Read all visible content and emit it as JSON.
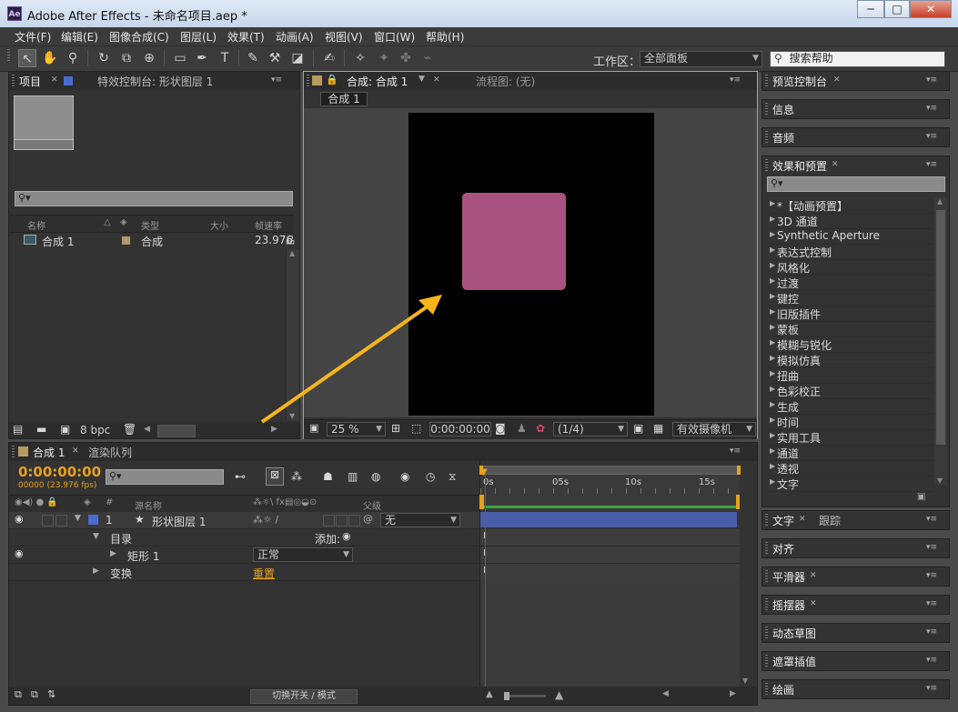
{
  "window": {
    "title": "Adobe After Effects - 未命名项目.aep *",
    "app_icon": "Ae",
    "minimize": "─",
    "maximize": "□",
    "close": "✕"
  },
  "menu": [
    "文件(F)",
    "编辑(E)",
    "图像合成(C)",
    "图层(L)",
    "效果(T)",
    "动画(A)",
    "视图(V)",
    "窗口(W)",
    "帮助(H)"
  ],
  "toolbar": {
    "workspace_label": "工作区：",
    "workspace_value": "全部面板",
    "search_placeholder": "搜索帮助"
  },
  "project_panel": {
    "tab_project": "项目",
    "tab_effects": "特效控制台: 形状图层 1",
    "columns": {
      "name": "名称",
      "type": "类型",
      "size": "大小",
      "fps": "帧速率"
    },
    "items": [
      {
        "name": "合成 1",
        "type": "合成",
        "size": "",
        "fps": "23.976"
      }
    ],
    "bpc": "8 bpc"
  },
  "comp_panel": {
    "tab_comp": "合成: 合成 1",
    "tab_flow": "流程图: (无)",
    "breadcrumb": "合成 1",
    "zoom": "25 %",
    "timecode": "0:00:00:00",
    "resolution": "(1/4)",
    "camera": "有效摄像机"
  },
  "right_panels": {
    "preview": "预览控制台",
    "info": "信息",
    "audio": "音频",
    "effects_presets": "效果和预置",
    "effects_list": [
      "*【动画预置】",
      "3D 通道",
      "Synthetic Aperture",
      "表达式控制",
      "风格化",
      "过渡",
      "键控",
      "旧版插件",
      "蒙板",
      "模糊与锐化",
      "模拟仿真",
      "扭曲",
      "色彩校正",
      "生成",
      "时间",
      "实用工具",
      "通道",
      "透视",
      "文字"
    ],
    "text": "文字",
    "tracker": "跟踪",
    "align": "对齐",
    "smoother": "平滑器",
    "wiggler": "摇摆器",
    "motion_sketch": "动态草图",
    "mask_interp": "遮罩插值",
    "paint": "绘画"
  },
  "timeline": {
    "tab_comp": "合成 1",
    "tab_render": "渲染队列",
    "timecode": "0:00:00:00",
    "frames": "00000 (23.976 fps)",
    "col_source": "源名称",
    "col_parent": "父级",
    "layer_num": "1",
    "layer_name": "形状图层 1",
    "parent_value": "无",
    "contents": "目录",
    "add": "添加:",
    "rect": "矩形 1",
    "blend": "正常",
    "transform": "变换",
    "reset": "重置",
    "ruler": [
      "0s",
      "05s",
      "10s",
      "15s"
    ],
    "footer_toggle": "切换开关 / 模式"
  },
  "colors": {
    "rect": "#a8537f",
    "arrow": "#f5b51b",
    "timecode": "#e6a21c",
    "layer_bar": "#4a5ea8"
  }
}
